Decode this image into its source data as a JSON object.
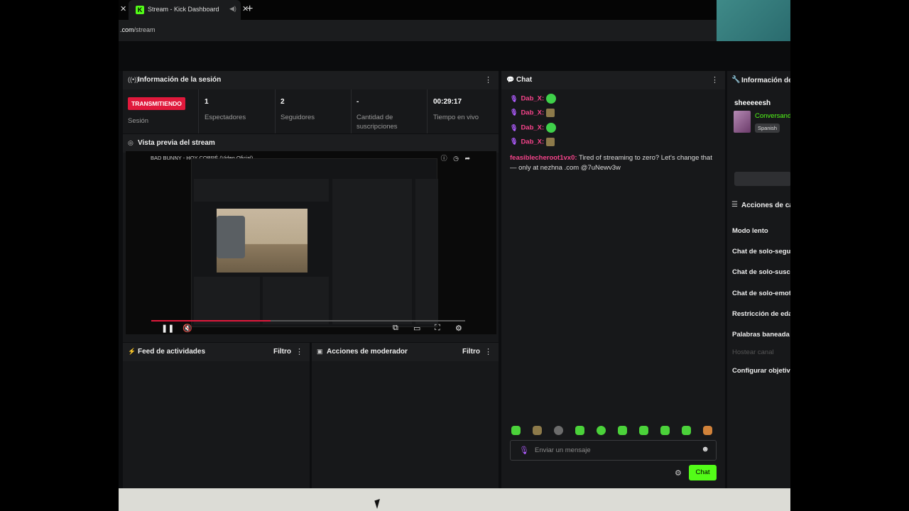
{
  "browser": {
    "tab_title": "Stream - Kick Dashboard",
    "favicon": "K",
    "url_domain": ".com",
    "url_path": "/stream"
  },
  "session": {
    "title": "Información de la sesión",
    "status_badge": "TRANSMITIENDO",
    "status_label": "Sesión",
    "stats": [
      {
        "value": "1",
        "label": "Espectadores"
      },
      {
        "value": "2",
        "label": "Seguidores"
      },
      {
        "value": "-",
        "label": "Cantidad de suscripciones"
      },
      {
        "value": "00:29:17",
        "label": "Tiempo en vivo"
      }
    ]
  },
  "preview": {
    "title": "Vista previa del stream",
    "video_title": "BAD BUNNY - HOY COBRÉ (Video Oficial)"
  },
  "activity_feed": {
    "title": "Feed de actividades",
    "filter": "Filtro"
  },
  "mod_actions": {
    "title": "Acciones de moderador",
    "filter": "Filtro"
  },
  "chat": {
    "title": "Chat",
    "messages": [
      {
        "user": "Dab_X:",
        "emote": "frog"
      },
      {
        "user": "Dab_X:",
        "emote": "box"
      },
      {
        "user": "Dab_X:",
        "emote": "frog"
      },
      {
        "user": "Dab_X:",
        "emote": "box"
      }
    ],
    "promo_user": "feasiblecheroot1vx0:",
    "promo_text": "Tired of streaming to zero? Let's change that — only at nezhna .com @7uNewv3w",
    "input_placeholder": "Enviar un mensaje",
    "send_label": "Chat"
  },
  "channel_info": {
    "title": "Información de",
    "channel_name": "sheeeeesh",
    "category": "Conversand",
    "language": "Spanish"
  },
  "channel_actions": {
    "title": "Acciones de ca",
    "items": [
      "Modo lento",
      "Chat de solo-segu",
      "Chat de solo-susc",
      "Chat de solo-emot",
      "Restricción de eda",
      "Palabras baneada",
      "Hostear canal",
      "Configurar objetiv"
    ]
  },
  "colors": {
    "accent": "#53fc18",
    "live": "#e0193c",
    "username": "#f5438a"
  }
}
